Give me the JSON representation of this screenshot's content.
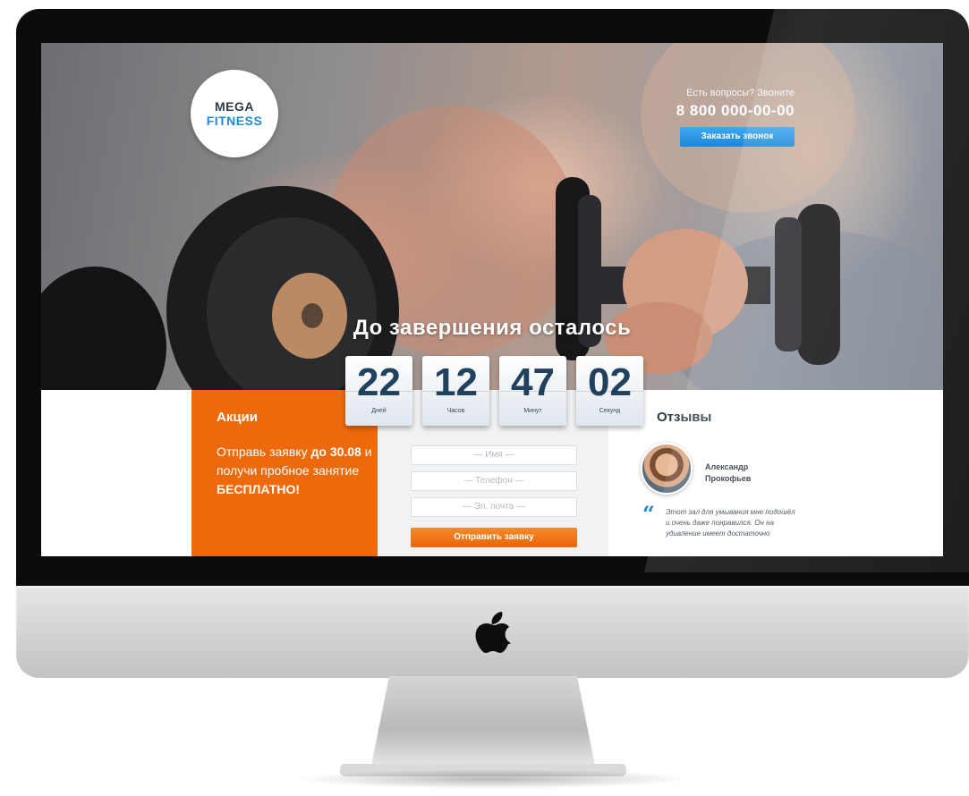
{
  "header": {
    "logo_line1": "MEGA",
    "logo_line2": "FITNESS",
    "contact_question": "Есть вопросы? Звоните",
    "phone": "8 800 000-00-00",
    "callback_button": "Заказать звонок"
  },
  "countdown": {
    "title": "До завершения осталось",
    "units": [
      {
        "value": "22",
        "label": "Дней"
      },
      {
        "value": "12",
        "label": "Часов"
      },
      {
        "value": "47",
        "label": "Минут"
      },
      {
        "value": "02",
        "label": "Секунд"
      }
    ]
  },
  "promo": {
    "title": "Акции",
    "text_before": "Отправь заявку ",
    "date": "до 30.08",
    "text_middle": " и получи пробное занятие ",
    "free": "БЕСПЛАТНО!"
  },
  "form": {
    "name_placeholder": "— Имя —",
    "phone_placeholder": "— Телефон —",
    "email_placeholder": "— Эл. почта —",
    "submit": "Отправить заявку"
  },
  "reviews": {
    "title": "Отзывы",
    "name_first": "Александр",
    "name_last": "Прокофьев",
    "quote_mark": "“",
    "text": "Этот зал для умывания мне подошёл и очень даже понравился. Он на удивление имеет достаточно"
  },
  "colors": {
    "accent_orange": "#ed6a0c",
    "accent_blue": "#1d8ad6",
    "dark_text": "#2f3a45"
  },
  "icons": [
    "apple-logo-icon",
    "quote-icon"
  ]
}
